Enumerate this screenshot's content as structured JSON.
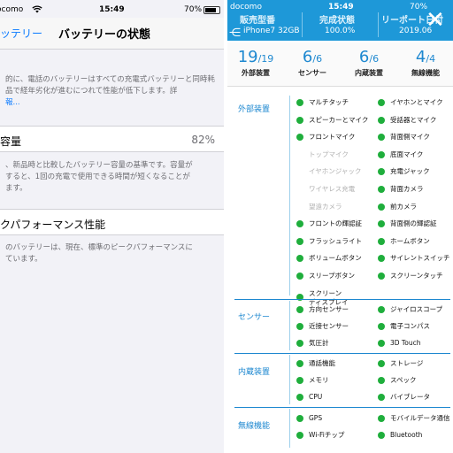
{
  "left": {
    "status": {
      "carrier": "ocomo",
      "wifi": "wifi-icon",
      "time": "15:49",
      "battery": "70%"
    },
    "nav": {
      "back": "ッテリー",
      "title": "バッテリーの状態"
    },
    "intro": "的に、電話のバッテリーはすべての充電式バッテリーと同時耗品で経年劣化が進むにつれて性能が低下します。詳",
    "intro_link": "詳",
    "intro_line3": "報...",
    "capacity": {
      "label": "容量",
      "value": "82%"
    },
    "capacity_desc_1": "、新品時と比較したバッテリー容量の基準です。容量が",
    "capacity_desc_2": "すると、1回の充電で使用できる時間が短くなることが",
    "capacity_desc_3": "ます。",
    "peak": {
      "label": "クパフォーマンス性能"
    },
    "peak_desc_1": "のバッテリーは、現在、標準のピークパフォーマンスに",
    "peak_desc_2": "ています。"
  },
  "right": {
    "status": {
      "carrier": "docomo",
      "time": "15:49",
      "battery": "70%"
    },
    "header": {
      "col1_title": "販売型番",
      "col1_value": "iPhone7 32GB",
      "col2_title": "完成状態",
      "col2_value": "100.0%",
      "col3_title": "リーポート日付",
      "col3_value": "2019.06"
    },
    "close_icon": "close-icon",
    "share_icon": "share-icon",
    "counts": [
      {
        "num": "19",
        "den": "/19",
        "caption": "外部装置"
      },
      {
        "num": "6",
        "den": "/6",
        "caption": "センサー"
      },
      {
        "num": "6",
        "den": "/6",
        "caption": "内蔵装置"
      },
      {
        "num": "4",
        "den": "/4",
        "caption": "無線機能"
      }
    ],
    "sections": {
      "external": "外部装置",
      "sensor": "センサー",
      "internal": "内蔵装置",
      "wireless": "無線機能"
    },
    "external_items": [
      {
        "label": "マルチタッチ",
        "on": true
      },
      {
        "label": "イヤホンとマイク",
        "on": true
      },
      {
        "label": "スピーカーとマイク",
        "on": true
      },
      {
        "label": "受話器とマイク",
        "on": true
      },
      {
        "label": "フロントマイク",
        "on": true
      },
      {
        "label": "背面側マイク",
        "on": true
      },
      {
        "label": "トップマイク",
        "on": false
      },
      {
        "label": "底面マイク",
        "on": true
      },
      {
        "label": "イヤホンジャック",
        "on": false
      },
      {
        "label": "充電ジャック",
        "on": true
      },
      {
        "label": "ワイヤレス充電",
        "on": false
      },
      {
        "label": "背面カメラ",
        "on": true
      },
      {
        "label": "望遠カメラ",
        "on": false
      },
      {
        "label": "前カメラ",
        "on": true
      },
      {
        "label": "フロントの輝認証",
        "on": true
      },
      {
        "label": "背面側の輝認証",
        "on": true
      },
      {
        "label": "フラッシュライト",
        "on": true
      },
      {
        "label": "ホームボタン",
        "on": true
      },
      {
        "label": "ボリュームボタン",
        "on": true
      },
      {
        "label": "サイレントスイッチ",
        "on": true
      },
      {
        "label": "スリープボタン",
        "on": true
      },
      {
        "label": "スクリーンタッチ",
        "on": true
      },
      {
        "label": "スクリーン",
        "label2": "ディスプレイ",
        "on": true
      }
    ],
    "sensor_items": [
      {
        "label": "方向センサー"
      },
      {
        "label": "ジャイロスコープ"
      },
      {
        "label": "近接センサー"
      },
      {
        "label": "電子コンパス"
      },
      {
        "label": "気圧計"
      },
      {
        "label": "3D Touch"
      }
    ],
    "internal_items": [
      {
        "label": "通話機能"
      },
      {
        "label": "ストレージ"
      },
      {
        "label": "メモリ"
      },
      {
        "label": "スペック"
      },
      {
        "label": "CPU"
      },
      {
        "label": "バイブレータ"
      }
    ],
    "wireless_items": [
      {
        "label": "GPS"
      },
      {
        "label": "モバイルデータ通信"
      },
      {
        "label": "Wi-Fiチップ"
      },
      {
        "label": "Bluetooth"
      }
    ]
  }
}
